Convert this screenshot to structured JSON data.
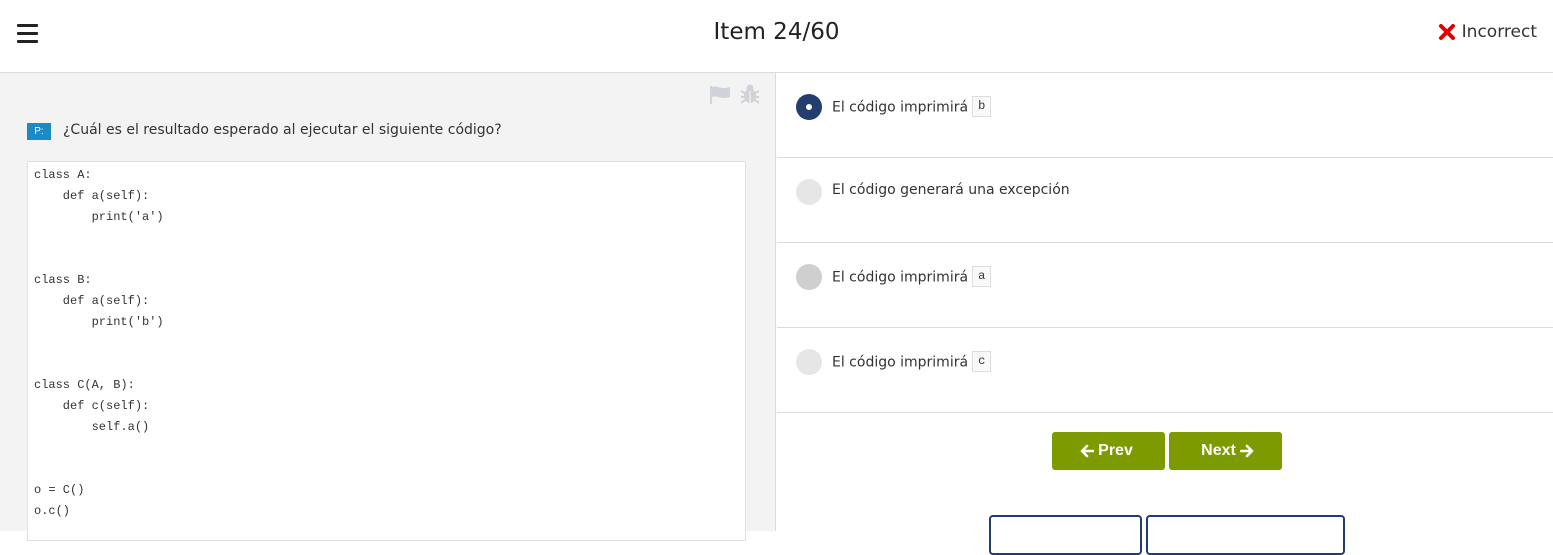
{
  "header": {
    "title": "Item 24/60",
    "status": "Incorrect",
    "status_icon": "x-icon",
    "status_color": "#e00000"
  },
  "question": {
    "badge": "P:",
    "text": "¿Cuál es el resultado esperado al ejecutar el siguiente código?",
    "code_lines": [
      "class A:",
      "    def a(self):",
      "        print('a')",
      "",
      "",
      "class B:",
      "    def a(self):",
      "        print('b')",
      "",
      "",
      "class C(A, B):",
      "    def c(self):",
      "        self.a()",
      "",
      "",
      "o = C()",
      "o.c()"
    ]
  },
  "options": [
    {
      "label": "El código imprimirá",
      "code": "b",
      "state": "selected"
    },
    {
      "label": "El código generará una excepción",
      "code": "",
      "state": "unselected"
    },
    {
      "label": "El código imprimirá",
      "code": "a",
      "state": "highlighted"
    },
    {
      "label": "El código imprimirá",
      "code": "c",
      "state": "unselected"
    }
  ],
  "nav": {
    "prev_label": "Prev",
    "next_label": "Next",
    "accent_color": "#7c9b00"
  },
  "colors": {
    "selected_radio": "#233d6e",
    "badge": "#1b8bc6"
  }
}
